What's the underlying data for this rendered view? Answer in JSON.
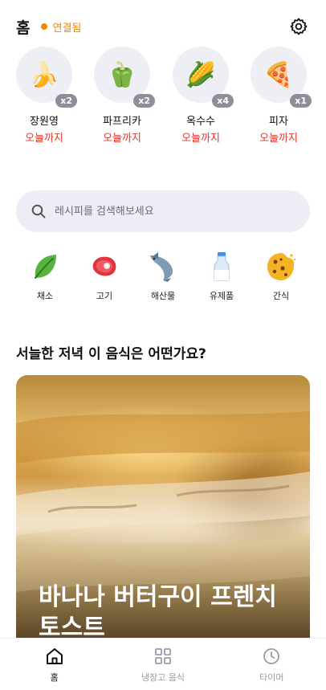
{
  "header": {
    "title": "홈",
    "status": "연결됨"
  },
  "fridge": {
    "items": [
      {
        "name": "장원영",
        "expiry": "오늘까지",
        "count": "x2",
        "emoji": "🍌",
        "icon": "banana-icon"
      },
      {
        "name": "파프리카",
        "expiry": "오늘까지",
        "count": "x2",
        "emoji": "🫑",
        "icon": "bell-pepper-icon"
      },
      {
        "name": "옥수수",
        "expiry": "오늘까지",
        "count": "x4",
        "emoji": "🌽",
        "icon": "corn-icon"
      },
      {
        "name": "피자",
        "expiry": "오늘까지",
        "count": "x1",
        "emoji": "🍕",
        "icon": "pizza-icon"
      }
    ]
  },
  "search": {
    "placeholder": "레시피를 검색해보세요"
  },
  "categories": [
    {
      "label": "채소",
      "icon": "leaf-icon"
    },
    {
      "label": "고기",
      "icon": "meat-icon"
    },
    {
      "label": "해산물",
      "icon": "fish-icon"
    },
    {
      "label": "유제품",
      "icon": "milk-icon"
    },
    {
      "label": "간식",
      "icon": "cookie-icon"
    }
  ],
  "recommend": {
    "heading": "서늘한 저녁 이 음식은 어떤가요?",
    "card_title": "바나나 버터구이 프렌치 토스트"
  },
  "nav": {
    "items": [
      {
        "label": "홈",
        "icon": "home-icon",
        "active": true
      },
      {
        "label": "냉장고 음식",
        "icon": "grid-icon",
        "active": false
      },
      {
        "label": "타이머",
        "icon": "clock-icon",
        "active": false
      }
    ]
  },
  "colors": {
    "accent": "#f08a00",
    "expiry": "#e8332b",
    "badge": "#8d8e99",
    "surface": "#ededf6"
  }
}
